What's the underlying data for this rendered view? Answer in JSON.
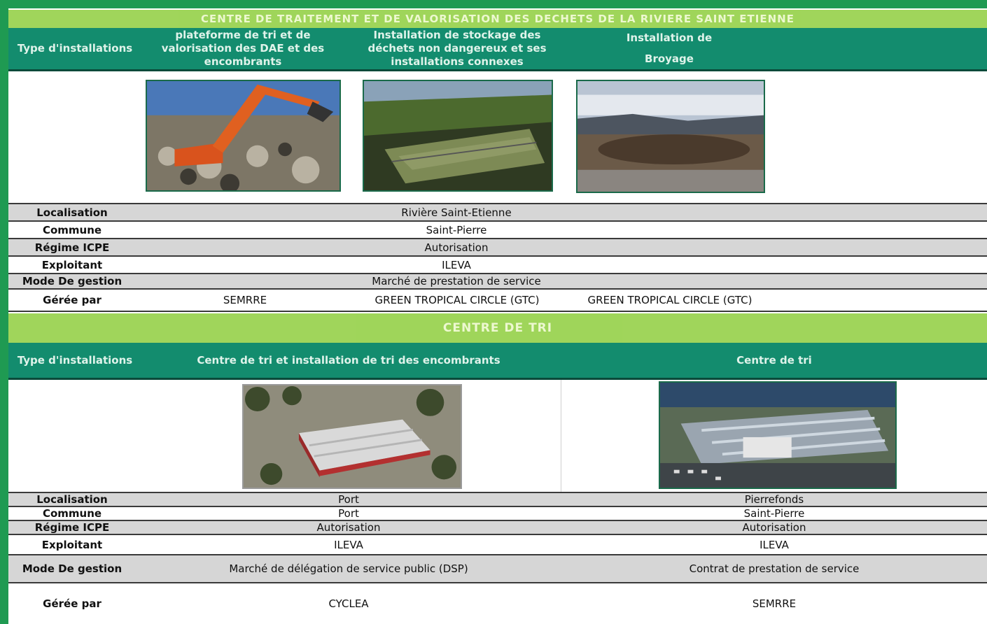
{
  "section1": {
    "title": "CENTRE DE TRAITEMENT ET DE VALORISATION DES DECHETS DE LA RIVIERE SAINT ETIENNE",
    "type_label": "Type d'installations",
    "columns": [
      "plateforme de tri et de valorisation des DAE et des encombrants",
      "Installation de stockage des déchets non dangereux et ses installations connexes",
      "Installation de\n\nBroyage"
    ],
    "images": [
      "excavator-photo",
      "landfill-photo",
      "shredding-site-photo"
    ],
    "rows": [
      {
        "label": "Localisation",
        "value": "Rivière Saint-Etienne"
      },
      {
        "label": "Commune",
        "value": "Saint-Pierre"
      },
      {
        "label": "Régime ICPE",
        "value": "Autorisation"
      },
      {
        "label": "Exploitant",
        "value": "ILEVA"
      },
      {
        "label": "Mode De gestion",
        "value": "Marché de prestation de service"
      }
    ],
    "managed": {
      "label": "Gérée par",
      "values": [
        "SEMRRE",
        "GREEN TROPICAL CIRCLE (GTC)",
        "GREEN TROPICAL CIRCLE (GTC)"
      ]
    }
  },
  "section2": {
    "title": "CENTRE DE TRI",
    "type_label": "Type d'installations",
    "columns": [
      "Centre de tri et installation de tri des encombrants",
      "Centre de tri"
    ],
    "images": [
      "sorting-center-port-photo",
      "sorting-center-pierrefonds-photo"
    ],
    "rows": [
      {
        "label": "Localisation",
        "values": [
          "Port",
          "Pierrefonds"
        ]
      },
      {
        "label": "Commune",
        "values": [
          "Port",
          "Saint-Pierre"
        ]
      },
      {
        "label": "Régime ICPE",
        "values": [
          "Autorisation",
          "Autorisation"
        ]
      },
      {
        "label": "Exploitant",
        "values": [
          "ILEVA",
          "ILEVA"
        ]
      },
      {
        "label": "Mode De gestion",
        "values": [
          "Marché de délégation de service public (DSP)",
          "Contrat de prestation de service"
        ]
      },
      {
        "label": "Gérée par",
        "values": [
          "CYCLEA",
          "SEMRRE"
        ]
      }
    ]
  },
  "colors": {
    "frame": "#1f9a52",
    "banner": "#8fce3e",
    "header": "#138c6e",
    "row_grey": "#d6d6d6"
  }
}
